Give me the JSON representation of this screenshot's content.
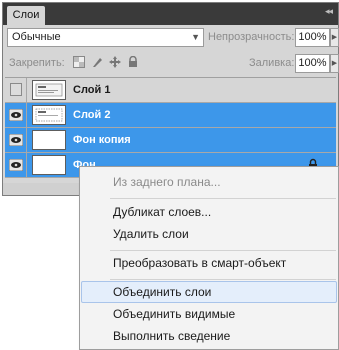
{
  "panel": {
    "tab_label": "Слои",
    "collapse_glyph": "◂◂",
    "blend_mode": "Обычные",
    "opacity_label": "Непрозрачность:",
    "opacity_value": "100%",
    "lock_label": "Закрепить:",
    "fill_label": "Заливка:",
    "fill_value": "100%",
    "lock_icons": [
      "lock-transparent-pixels-icon",
      "lock-image-pixels-icon",
      "lock-position-icon",
      "lock-all-icon"
    ]
  },
  "layers": [
    {
      "name": "Слой 1",
      "visible": false,
      "selected": false
    },
    {
      "name": "Слой 2",
      "visible": true,
      "selected": true
    },
    {
      "name": "Фон копия",
      "visible": true,
      "selected": true
    },
    {
      "name": "Фон",
      "visible": true,
      "selected": true,
      "locked": true
    }
  ],
  "context_menu": {
    "items": [
      {
        "label": "Из заднего плана...",
        "disabled": true
      },
      {
        "label": "Дубликат слоев..."
      },
      {
        "label": "Удалить слои"
      },
      {
        "label": "Преобразовать в смарт-объект"
      },
      {
        "label": "Объединить слои",
        "hovered": true
      },
      {
        "label": "Объединить видимые"
      },
      {
        "label": "Выполнить сведение"
      }
    ]
  },
  "colors": {
    "selection": "#3d97ea",
    "panel_bg": "#d6d6d6",
    "tabbar_bg": "#3a3a3a",
    "menu_hover": "#e4eefb"
  }
}
